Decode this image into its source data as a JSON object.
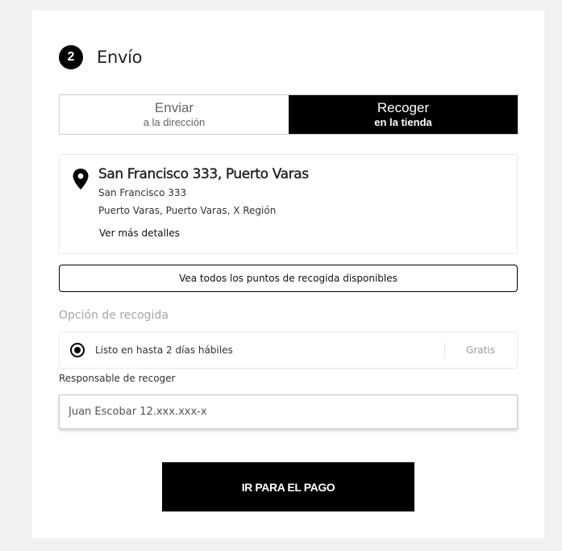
{
  "step": {
    "number": "2",
    "title": "Envío"
  },
  "delivery_toggle": {
    "ship": {
      "main": "Enviar",
      "sub": "a la dirección"
    },
    "pickup": {
      "main": "Recoger",
      "sub": "en la tienda"
    },
    "selected": "pickup"
  },
  "store": {
    "icon": "map-pin-icon",
    "name": "San Francisco 333, Puerto Varas",
    "line1": "San Francisco 333",
    "line2": "Puerto Varas, Puerto Varas, X Región",
    "details_link": "Ver más detalles"
  },
  "points_button": "Vea todos los puntos de recogida disponibles",
  "pickup_option": {
    "section_label": "Opción de recogida",
    "label": "Listo en hasta 2 días hábiles",
    "price": "Gratis",
    "selected": true
  },
  "responsible": {
    "label": "Responsable de recoger",
    "value": "Juan Escobar 12.xxx.xxx-x"
  },
  "pay_button": "IR PARA EL PAGO",
  "colors": {
    "background": "#f3f2f2",
    "panel": "#ffffff",
    "accent": "#000000"
  }
}
